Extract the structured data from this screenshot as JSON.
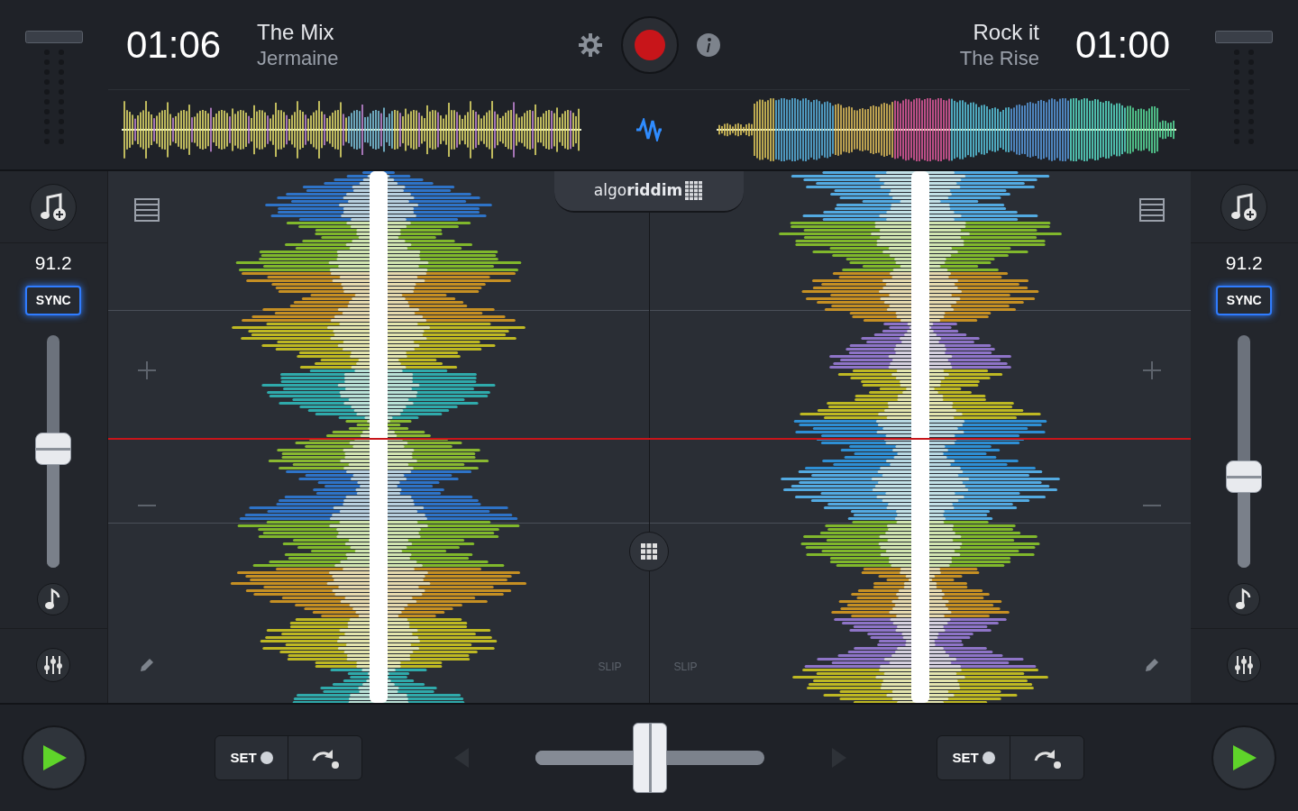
{
  "decks": [
    {
      "time": "01:06",
      "title": "The Mix",
      "artist": "Jermaine",
      "bpm": "91.2",
      "sync": {
        "label": "SYNC",
        "on": true
      },
      "pitch": {
        "level": 0.51
      },
      "slip_label": "SLIP",
      "set_label": "SET"
    },
    {
      "time": "01:00",
      "title": "Rock it",
      "artist": "The Rise",
      "bpm": "91.2",
      "sync": {
        "label": "SYNC",
        "on": true
      },
      "pitch": {
        "level": 0.39
      },
      "slip_label": "SLIP",
      "set_label": "SET"
    }
  ],
  "logo": "algo**riddim**",
  "crossfader": {
    "level": 0.5
  }
}
